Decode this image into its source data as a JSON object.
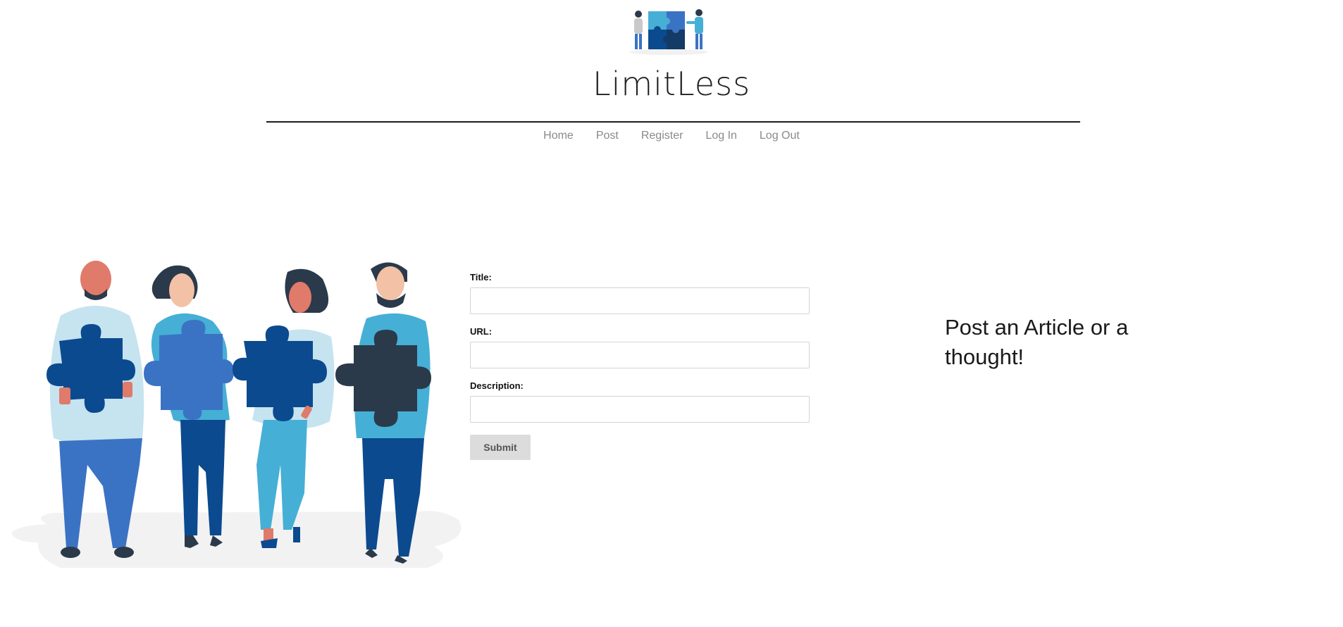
{
  "header": {
    "logo_icon": "puzzle-team-logo",
    "title": "LimitLess"
  },
  "nav": {
    "items": [
      {
        "label": "Home"
      },
      {
        "label": "Post"
      },
      {
        "label": "Register"
      },
      {
        "label": "Log In"
      },
      {
        "label": "Log Out"
      }
    ]
  },
  "hero": {
    "image": "people-holding-puzzle-pieces-illustration"
  },
  "form": {
    "title_label": "Title:",
    "title_value": "",
    "url_label": "URL:",
    "url_value": "",
    "description_label": "Description:",
    "description_value": "",
    "submit_label": "Submit"
  },
  "tagline": "Post an Article or a thought!",
  "colors": {
    "navy": "#0b4a8f",
    "blue": "#3b73c4",
    "light_blue": "#46afd6",
    "pale_blue": "#c6e3f0",
    "dark": "#2b3a4a",
    "skin": "#e07a6a",
    "nav_text": "#8a8a8a",
    "button_bg": "#dcdcdc"
  }
}
